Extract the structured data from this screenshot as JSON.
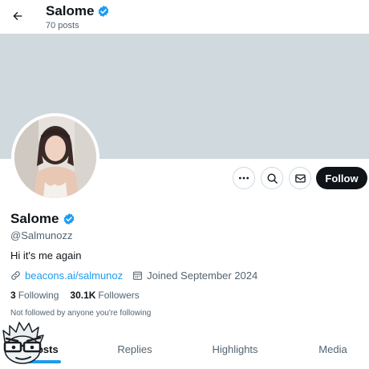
{
  "header": {
    "back_icon": "arrow-left-icon",
    "name": "Salome",
    "verified_icon": "verified-badge-icon",
    "posts_count": "70 posts"
  },
  "colors": {
    "accent": "#1d9bf0",
    "banner": "#cfd9de",
    "text_primary": "#0f1419",
    "text_secondary": "#536471",
    "follow_button_bg": "#0f1419"
  },
  "actions": {
    "more_icon": "more-horizontal-icon",
    "search_icon": "search-icon",
    "message_icon": "envelope-icon",
    "follow_label": "Follow"
  },
  "profile": {
    "name": "Salome",
    "handle": "@Salmunozz",
    "bio": "Hi it's me again",
    "link_icon": "link-icon",
    "link_text": "beacons.ai/salmunoz",
    "calendar_icon": "calendar-icon",
    "joined": "Joined September 2024",
    "following_count": "3",
    "following_label": "Following",
    "followers_count": "30.1K",
    "followers_label": "Followers",
    "followed_by_note": "Not followed by anyone you're following"
  },
  "tabs": [
    {
      "label": "Posts",
      "visible_label": "sts",
      "active": true
    },
    {
      "label": "Replies",
      "active": false
    },
    {
      "label": "Highlights",
      "active": false
    },
    {
      "label": "Media",
      "active": false
    }
  ]
}
